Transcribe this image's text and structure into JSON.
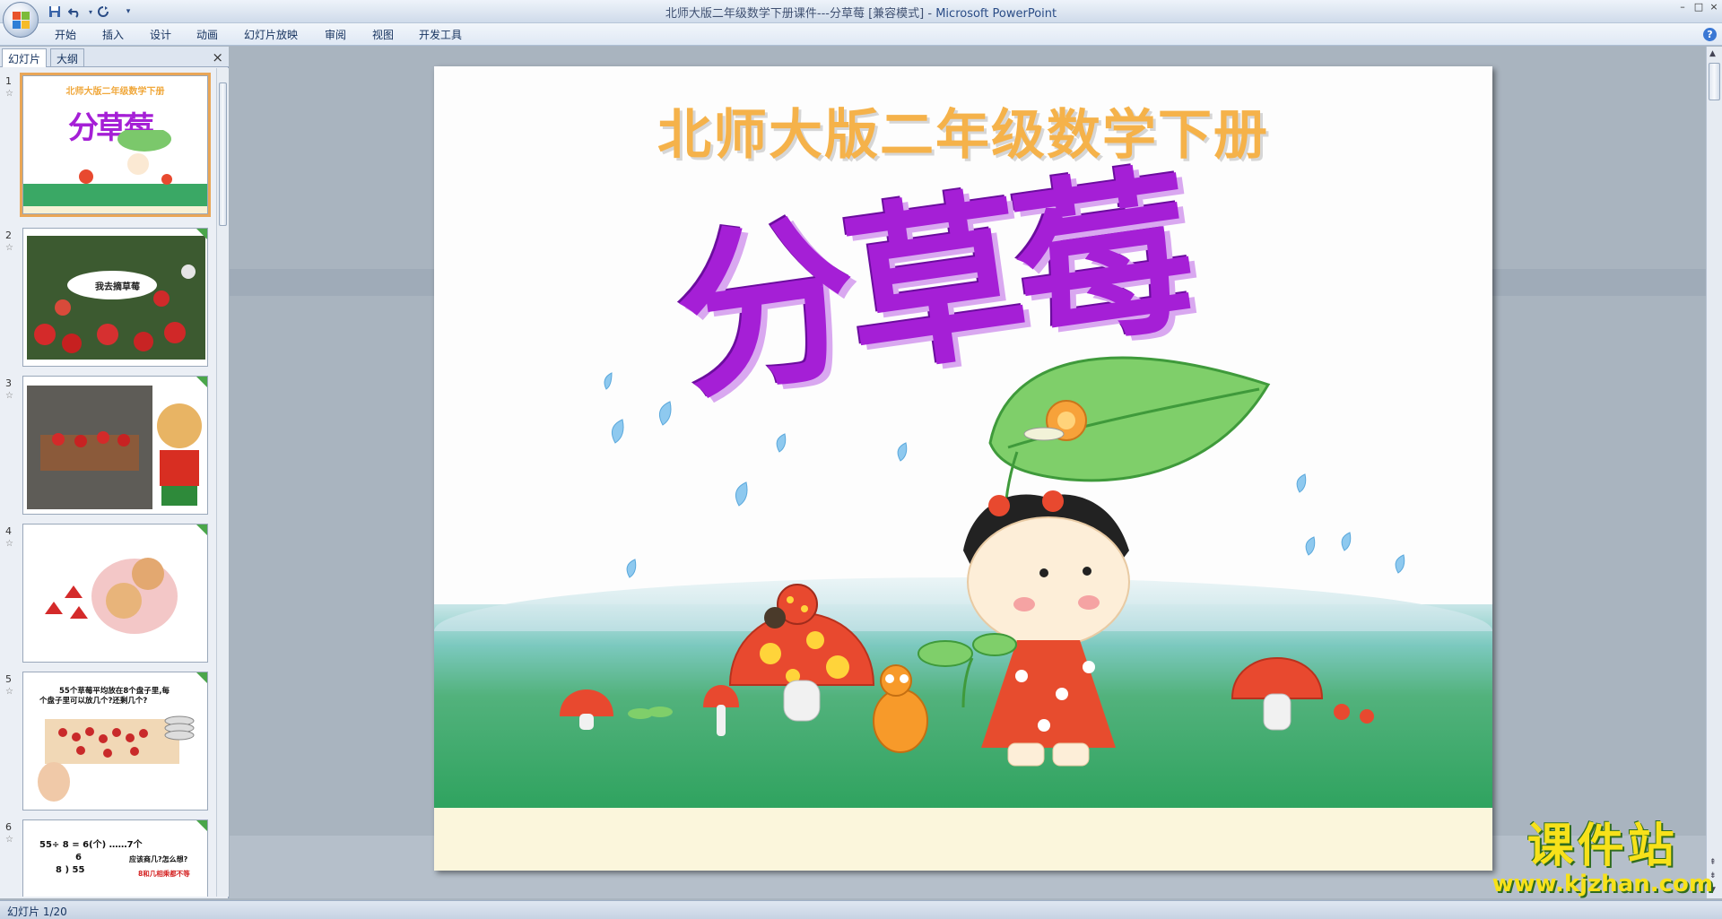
{
  "window": {
    "title": "北师大版二年级数学下册课件---分草莓 [兼容模式] - ",
    "app_name": "Microsoft PowerPoint",
    "controls": [
      "–",
      "□",
      "×"
    ]
  },
  "quick_access": {
    "save_icon": "save-icon",
    "undo_icon": "undo-icon",
    "redo_icon": "redo-icon",
    "customize_icon": "customize-qat-icon"
  },
  "ribbon": {
    "tabs": [
      "开始",
      "插入",
      "设计",
      "动画",
      "幻灯片放映",
      "审阅",
      "视图",
      "开发工具"
    ],
    "help": "?"
  },
  "left_pane": {
    "tabs": [
      "幻灯片",
      "大纲"
    ],
    "close": "×",
    "slides": [
      {
        "num": "1",
        "title": "北师大版二年级数学下册",
        "big": "分草莓"
      },
      {
        "num": "2",
        "bubble": "我去摘草莓"
      },
      {
        "num": "3"
      },
      {
        "num": "4"
      },
      {
        "num": "5",
        "text1": "55个草莓平均放在8个盘子里,每",
        "text2": "个盘子里可以放几个?还剩几个?"
      },
      {
        "num": "6",
        "eq": "55÷ 8 = 6(个) ……7个",
        "q": "应该商几?怎么想?",
        "d1": "6",
        "d2": "8 ) 55",
        "note": "8和几相乘都不等"
      }
    ]
  },
  "slide": {
    "subtitle": "北师大版二年级数学下册",
    "title": "分草莓"
  },
  "status": {
    "text": "幻灯片 1/20"
  },
  "watermark": {
    "cn": "课件站",
    "url": "www.kjzhan.com"
  },
  "colors": {
    "title_purple": "#a51fd6",
    "subtitle_orange": "#f5b24a",
    "ribbon_text": "#15325e",
    "selected_thumb": "#e9a657"
  }
}
